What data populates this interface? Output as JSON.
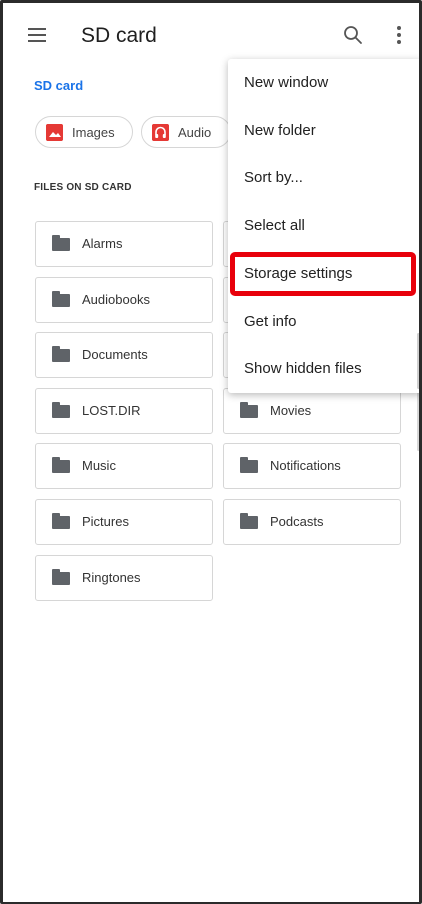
{
  "app_bar": {
    "title": "SD card",
    "icons": [
      "menu-icon",
      "search-icon",
      "more-vert-icon"
    ]
  },
  "breadcrumb": "SD card",
  "chips": [
    {
      "label": "Images",
      "icon": "image-icon",
      "color": "#e53935"
    },
    {
      "label": "Audio",
      "icon": "audio-icon",
      "color": "#e53935"
    }
  ],
  "section_label": "FILES ON SD CARD",
  "folders": [
    {
      "name": "Alarms"
    },
    {
      "name": "Audiobooks"
    },
    {
      "name": "Documents"
    },
    {
      "name": "LOST.DIR"
    },
    {
      "name": "Movies"
    },
    {
      "name": "Music"
    },
    {
      "name": "Notifications"
    },
    {
      "name": "Pictures"
    },
    {
      "name": "Podcasts"
    },
    {
      "name": "Ringtones"
    }
  ],
  "overflow_menu": {
    "items": [
      {
        "label": "New window"
      },
      {
        "label": "New folder"
      },
      {
        "label": "Sort by..."
      },
      {
        "label": "Select all"
      },
      {
        "label": "Storage settings",
        "highlighted": true
      },
      {
        "label": "Get info"
      },
      {
        "label": "Show hidden files"
      }
    ]
  },
  "colors": {
    "accent": "#1a73e8",
    "highlight": "#e8000b",
    "chip_icon": "#e53935"
  }
}
